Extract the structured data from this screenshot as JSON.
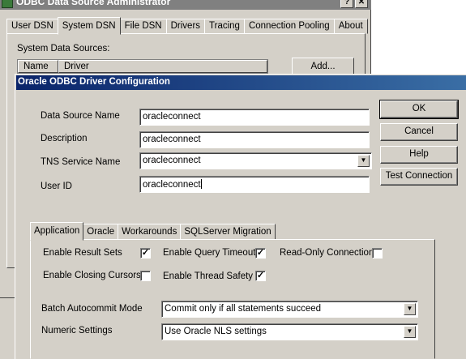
{
  "background_window": {
    "title": "ODBC Data Source Administrator",
    "help_button": "?",
    "close_button": "✕",
    "tabs": [
      "User DSN",
      "System DSN",
      "File DSN",
      "Drivers",
      "Tracing",
      "Connection Pooling",
      "About"
    ],
    "active_tab": "System DSN",
    "system_data_sources_label": "System Data Sources:",
    "columns": [
      "Name",
      "Driver"
    ],
    "add_button": "Add..."
  },
  "dialog": {
    "title": "Oracle ODBC Driver Configuration",
    "fields": {
      "dsn_label": "Data Source Name",
      "dsn_value": "oracleconnect",
      "description_label": "Description",
      "description_value": "oracleconnect",
      "tns_label": "TNS Service Name",
      "tns_value": "oracleconnect",
      "userid_label": "User ID",
      "userid_value": "oracleconnect"
    },
    "buttons": {
      "ok": "OK",
      "cancel": "Cancel",
      "help": "Help",
      "test_connection": "Test Connection"
    },
    "tabs": [
      "Application",
      "Oracle",
      "Workarounds",
      "SQLServer Migration"
    ],
    "active_tab": "Application",
    "options": {
      "enable_result_sets_label": "Enable Result Sets",
      "enable_result_sets_checked": true,
      "enable_query_timeout_label": "Enable Query Timeout",
      "enable_query_timeout_checked": true,
      "read_only_connection_label": "Read-Only Connection",
      "read_only_connection_checked": false,
      "enable_closing_cursors_label": "Enable Closing Cursors",
      "enable_closing_cursors_checked": false,
      "enable_thread_safety_label": "Enable Thread Safety",
      "enable_thread_safety_checked": true,
      "batch_autocommit_label": "Batch Autocommit Mode",
      "batch_autocommit_value": "Commit only if all statements succeed",
      "numeric_settings_label": "Numeric Settings",
      "numeric_settings_value": "Use Oracle NLS settings"
    },
    "check_glyph": "✓",
    "dropdown_glyph": "▼"
  },
  "colors": {
    "window_face": "#d4d0c8",
    "title_active_start": "#0a246a",
    "title_active_end": "#3a6ea5",
    "title_inactive": "#808080"
  }
}
